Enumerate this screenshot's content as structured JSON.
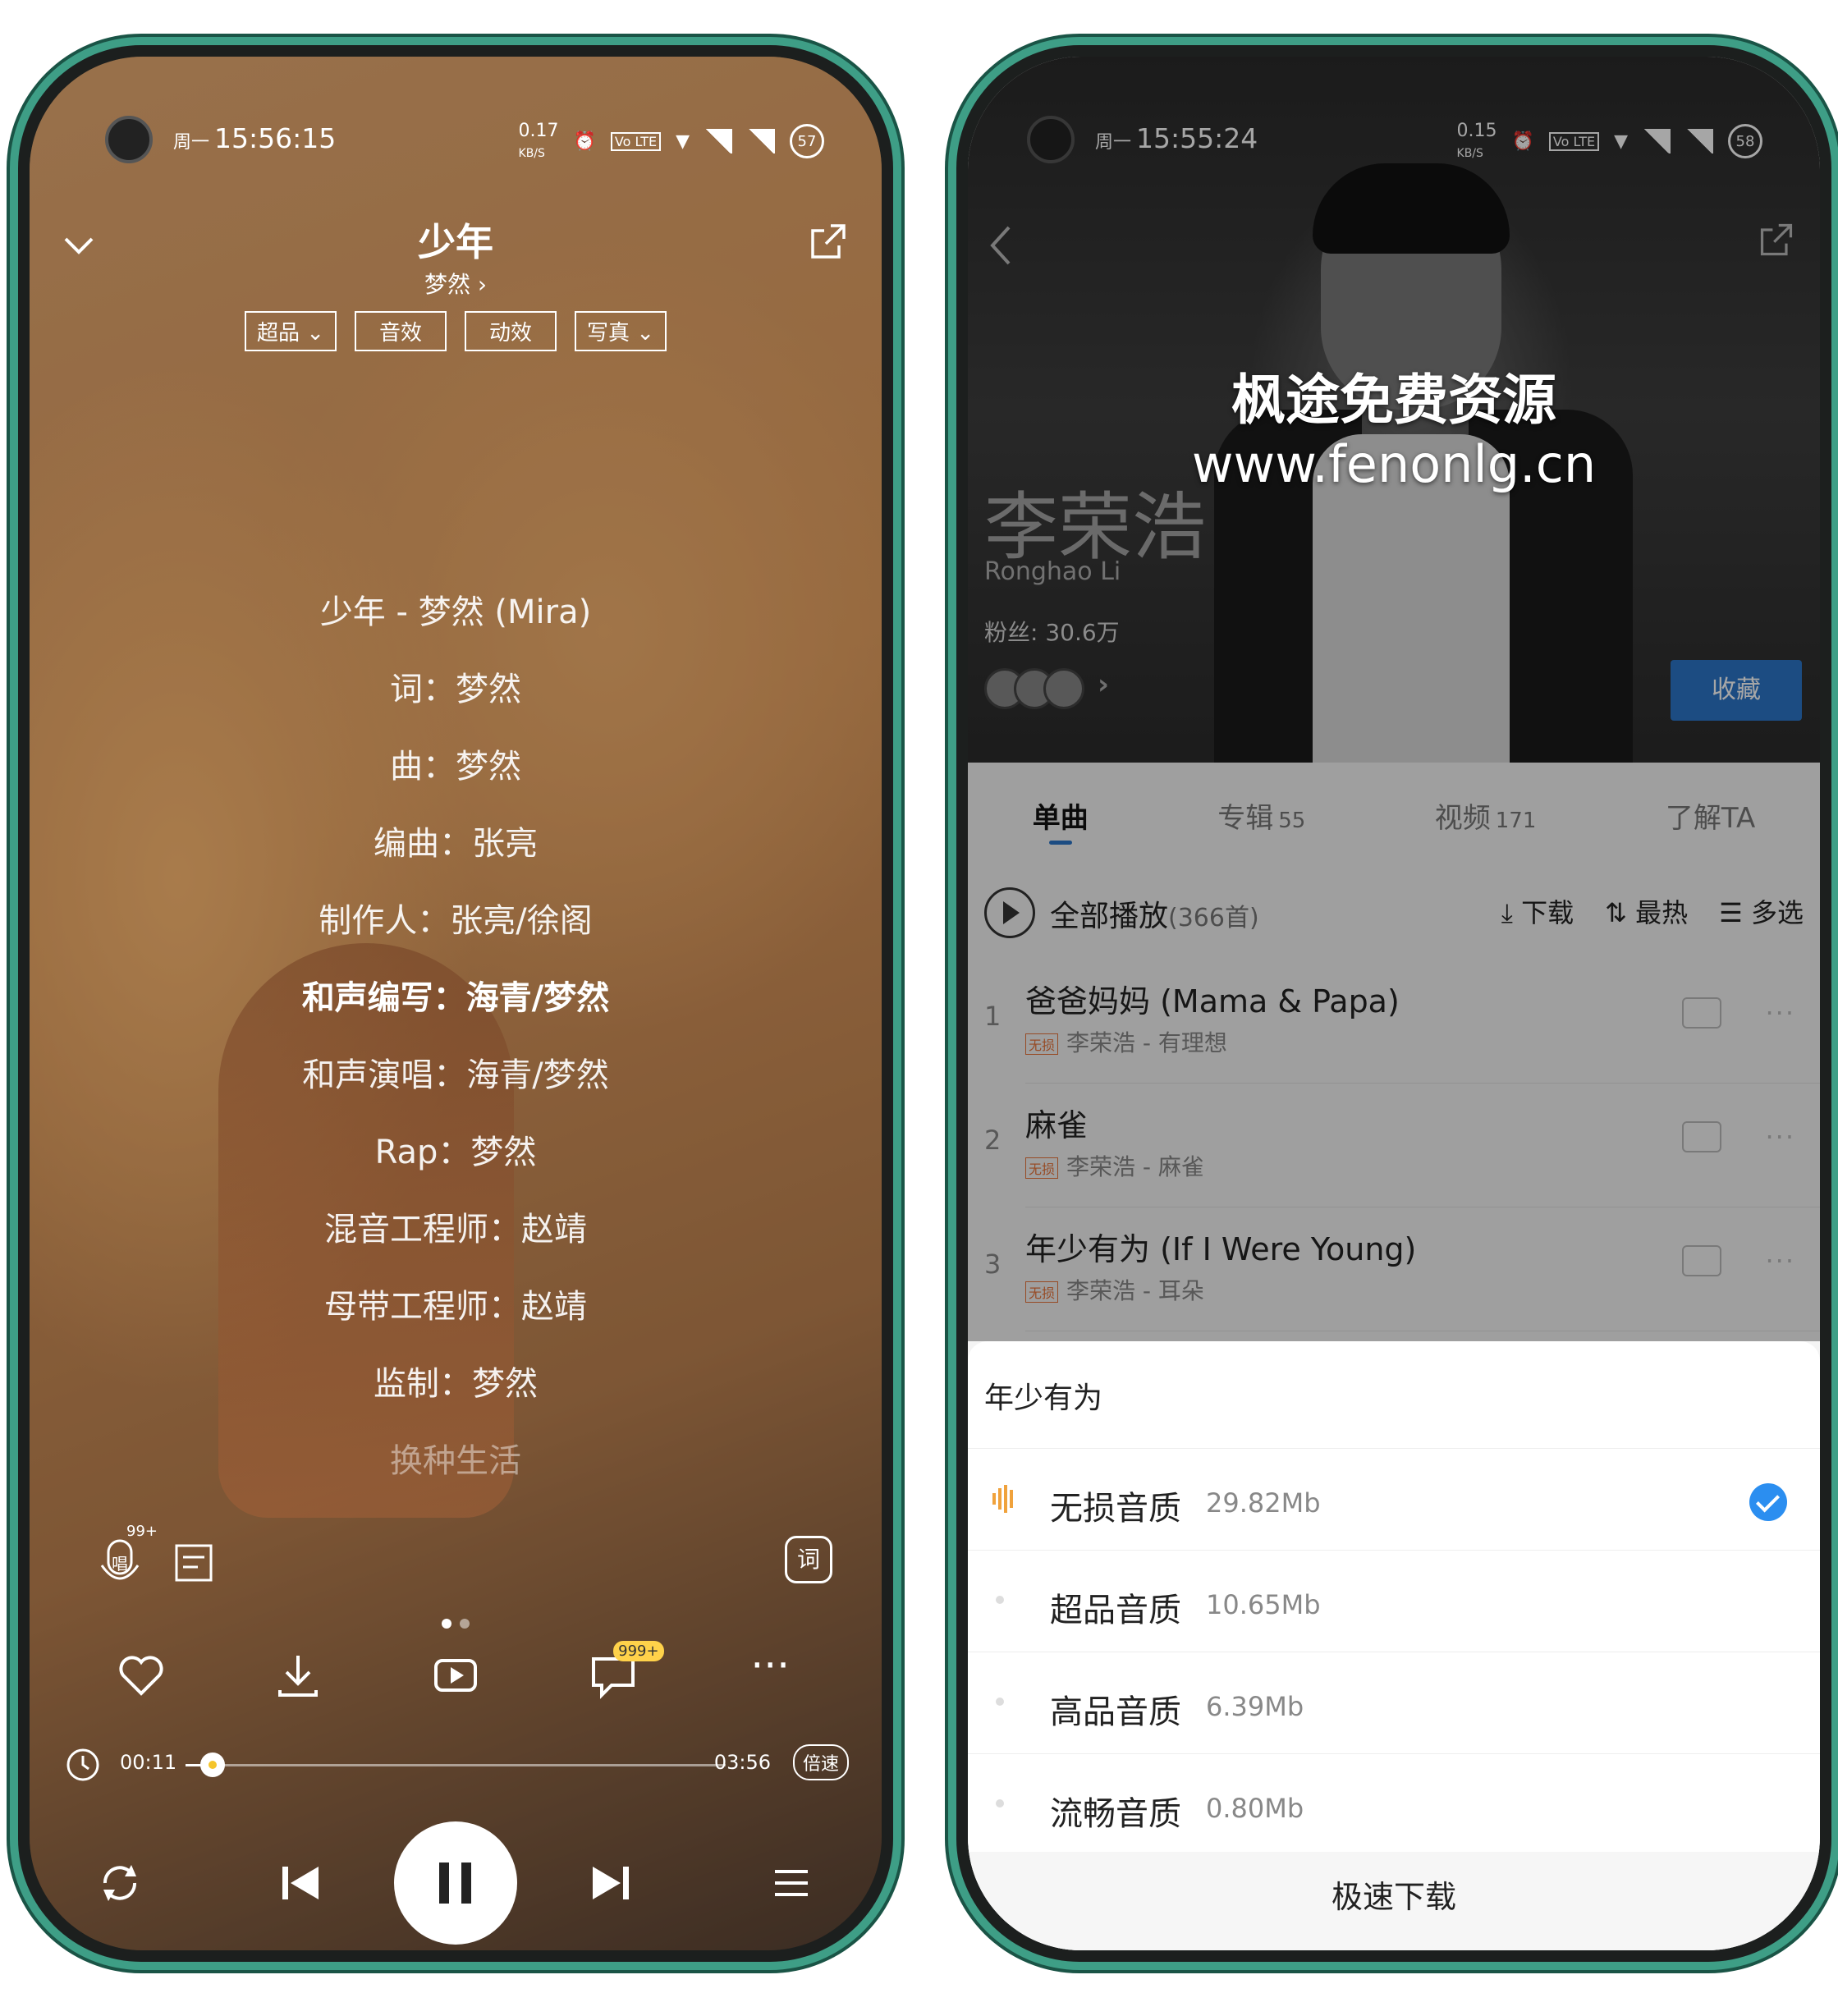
{
  "left": {
    "status": {
      "day": "周一",
      "time": "15:56:15",
      "speed": "0.17",
      "speed_unit": "KB/S",
      "volte": "Vo LTE",
      "battery": "57"
    },
    "song_title": "少年",
    "artist": "梦然",
    "chips": [
      "超品",
      "音效",
      "动效",
      "写真"
    ],
    "lyrics": [
      "少年 - 梦然 (Mira)",
      "词：梦然",
      "曲：梦然",
      "编曲：张亮",
      "制作人：张亮/徐阁",
      "和声编写：海青/梦然",
      "和声演唱：海青/梦然",
      "Rap：梦然",
      "混音工程师：赵靖",
      "母带工程师：赵靖",
      "监制：梦然",
      "换种生活"
    ],
    "current_lyric_index": 5,
    "sing_badge": "99+",
    "sing_label": "唱",
    "lyric_btn": "词",
    "comment_badge": "999+",
    "progress": {
      "current": "00:11",
      "total": "03:56",
      "rate_label": "倍速",
      "fraction": 0.05
    }
  },
  "right": {
    "status": {
      "day": "周一",
      "time": "15:55:24",
      "speed": "0.15",
      "speed_unit": "KB/S",
      "volte": "Vo LTE",
      "battery": "58"
    },
    "watermark_line1": "枫途免费资源",
    "watermark_line2": "www.fenonlg.cn",
    "artist_name": "李荣浩",
    "artist_en": "Ronghao Li",
    "fans": "粉丝: 30.6万",
    "favorite": "收藏",
    "tabs": [
      {
        "label": "单曲",
        "count": ""
      },
      {
        "label": "专辑",
        "count": "55"
      },
      {
        "label": "视频",
        "count": "171"
      },
      {
        "label": "了解TA",
        "count": ""
      }
    ],
    "play_all": "全部播放",
    "play_all_count": "(366首)",
    "ops": [
      "下载",
      "最热",
      "多选"
    ],
    "songs": [
      {
        "num": "1",
        "name": "爸爸妈妈 (Mama & Papa)",
        "tag": "无损",
        "sub": "李荣浩 - 有理想"
      },
      {
        "num": "2",
        "name": "麻雀",
        "tag": "无损",
        "sub": "李荣浩 - 麻雀"
      },
      {
        "num": "3",
        "name": "年少有为 (If I Were Young)",
        "tag": "无损",
        "sub": "李荣浩 - 耳朵"
      }
    ],
    "sheet": {
      "title": "年少有为",
      "options": [
        {
          "label": "无损音质",
          "size": "29.82Mb",
          "selected": true
        },
        {
          "label": "超品音质",
          "size": "10.65Mb",
          "selected": false
        },
        {
          "label": "高品音质",
          "size": "6.39Mb",
          "selected": false
        },
        {
          "label": "流畅音质",
          "size": "0.80Mb",
          "selected": false
        }
      ],
      "fast_download": "极速下载"
    }
  }
}
